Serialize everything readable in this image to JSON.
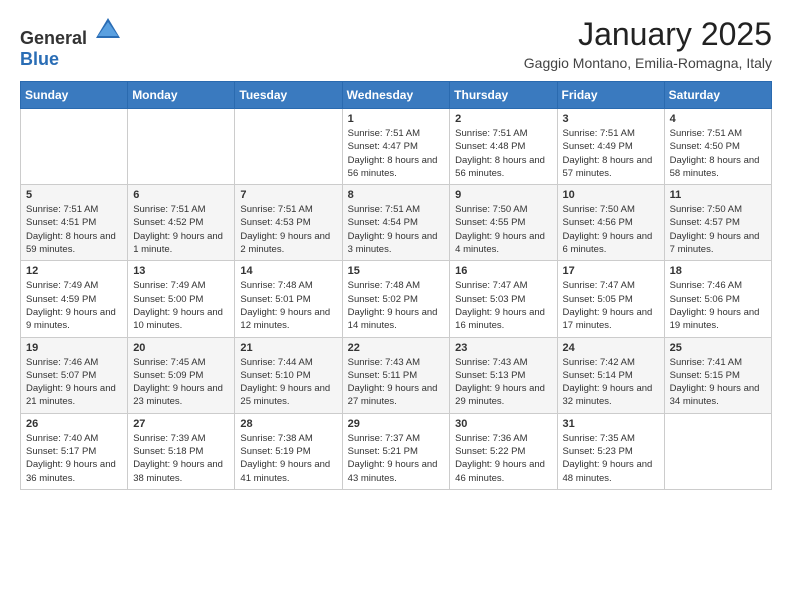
{
  "logo": {
    "general": "General",
    "blue": "Blue"
  },
  "header": {
    "month": "January 2025",
    "location": "Gaggio Montano, Emilia-Romagna, Italy"
  },
  "weekdays": [
    "Sunday",
    "Monday",
    "Tuesday",
    "Wednesday",
    "Thursday",
    "Friday",
    "Saturday"
  ],
  "weeks": [
    [
      {
        "day": "",
        "sunrise": "",
        "sunset": "",
        "daylight": ""
      },
      {
        "day": "",
        "sunrise": "",
        "sunset": "",
        "daylight": ""
      },
      {
        "day": "",
        "sunrise": "",
        "sunset": "",
        "daylight": ""
      },
      {
        "day": "1",
        "sunrise": "Sunrise: 7:51 AM",
        "sunset": "Sunset: 4:47 PM",
        "daylight": "Daylight: 8 hours and 56 minutes."
      },
      {
        "day": "2",
        "sunrise": "Sunrise: 7:51 AM",
        "sunset": "Sunset: 4:48 PM",
        "daylight": "Daylight: 8 hours and 56 minutes."
      },
      {
        "day": "3",
        "sunrise": "Sunrise: 7:51 AM",
        "sunset": "Sunset: 4:49 PM",
        "daylight": "Daylight: 8 hours and 57 minutes."
      },
      {
        "day": "4",
        "sunrise": "Sunrise: 7:51 AM",
        "sunset": "Sunset: 4:50 PM",
        "daylight": "Daylight: 8 hours and 58 minutes."
      }
    ],
    [
      {
        "day": "5",
        "sunrise": "Sunrise: 7:51 AM",
        "sunset": "Sunset: 4:51 PM",
        "daylight": "Daylight: 8 hours and 59 minutes."
      },
      {
        "day": "6",
        "sunrise": "Sunrise: 7:51 AM",
        "sunset": "Sunset: 4:52 PM",
        "daylight": "Daylight: 9 hours and 1 minute."
      },
      {
        "day": "7",
        "sunrise": "Sunrise: 7:51 AM",
        "sunset": "Sunset: 4:53 PM",
        "daylight": "Daylight: 9 hours and 2 minutes."
      },
      {
        "day": "8",
        "sunrise": "Sunrise: 7:51 AM",
        "sunset": "Sunset: 4:54 PM",
        "daylight": "Daylight: 9 hours and 3 minutes."
      },
      {
        "day": "9",
        "sunrise": "Sunrise: 7:50 AM",
        "sunset": "Sunset: 4:55 PM",
        "daylight": "Daylight: 9 hours and 4 minutes."
      },
      {
        "day": "10",
        "sunrise": "Sunrise: 7:50 AM",
        "sunset": "Sunset: 4:56 PM",
        "daylight": "Daylight: 9 hours and 6 minutes."
      },
      {
        "day": "11",
        "sunrise": "Sunrise: 7:50 AM",
        "sunset": "Sunset: 4:57 PM",
        "daylight": "Daylight: 9 hours and 7 minutes."
      }
    ],
    [
      {
        "day": "12",
        "sunrise": "Sunrise: 7:49 AM",
        "sunset": "Sunset: 4:59 PM",
        "daylight": "Daylight: 9 hours and 9 minutes."
      },
      {
        "day": "13",
        "sunrise": "Sunrise: 7:49 AM",
        "sunset": "Sunset: 5:00 PM",
        "daylight": "Daylight: 9 hours and 10 minutes."
      },
      {
        "day": "14",
        "sunrise": "Sunrise: 7:48 AM",
        "sunset": "Sunset: 5:01 PM",
        "daylight": "Daylight: 9 hours and 12 minutes."
      },
      {
        "day": "15",
        "sunrise": "Sunrise: 7:48 AM",
        "sunset": "Sunset: 5:02 PM",
        "daylight": "Daylight: 9 hours and 14 minutes."
      },
      {
        "day": "16",
        "sunrise": "Sunrise: 7:47 AM",
        "sunset": "Sunset: 5:03 PM",
        "daylight": "Daylight: 9 hours and 16 minutes."
      },
      {
        "day": "17",
        "sunrise": "Sunrise: 7:47 AM",
        "sunset": "Sunset: 5:05 PM",
        "daylight": "Daylight: 9 hours and 17 minutes."
      },
      {
        "day": "18",
        "sunrise": "Sunrise: 7:46 AM",
        "sunset": "Sunset: 5:06 PM",
        "daylight": "Daylight: 9 hours and 19 minutes."
      }
    ],
    [
      {
        "day": "19",
        "sunrise": "Sunrise: 7:46 AM",
        "sunset": "Sunset: 5:07 PM",
        "daylight": "Daylight: 9 hours and 21 minutes."
      },
      {
        "day": "20",
        "sunrise": "Sunrise: 7:45 AM",
        "sunset": "Sunset: 5:09 PM",
        "daylight": "Daylight: 9 hours and 23 minutes."
      },
      {
        "day": "21",
        "sunrise": "Sunrise: 7:44 AM",
        "sunset": "Sunset: 5:10 PM",
        "daylight": "Daylight: 9 hours and 25 minutes."
      },
      {
        "day": "22",
        "sunrise": "Sunrise: 7:43 AM",
        "sunset": "Sunset: 5:11 PM",
        "daylight": "Daylight: 9 hours and 27 minutes."
      },
      {
        "day": "23",
        "sunrise": "Sunrise: 7:43 AM",
        "sunset": "Sunset: 5:13 PM",
        "daylight": "Daylight: 9 hours and 29 minutes."
      },
      {
        "day": "24",
        "sunrise": "Sunrise: 7:42 AM",
        "sunset": "Sunset: 5:14 PM",
        "daylight": "Daylight: 9 hours and 32 minutes."
      },
      {
        "day": "25",
        "sunrise": "Sunrise: 7:41 AM",
        "sunset": "Sunset: 5:15 PM",
        "daylight": "Daylight: 9 hours and 34 minutes."
      }
    ],
    [
      {
        "day": "26",
        "sunrise": "Sunrise: 7:40 AM",
        "sunset": "Sunset: 5:17 PM",
        "daylight": "Daylight: 9 hours and 36 minutes."
      },
      {
        "day": "27",
        "sunrise": "Sunrise: 7:39 AM",
        "sunset": "Sunset: 5:18 PM",
        "daylight": "Daylight: 9 hours and 38 minutes."
      },
      {
        "day": "28",
        "sunrise": "Sunrise: 7:38 AM",
        "sunset": "Sunset: 5:19 PM",
        "daylight": "Daylight: 9 hours and 41 minutes."
      },
      {
        "day": "29",
        "sunrise": "Sunrise: 7:37 AM",
        "sunset": "Sunset: 5:21 PM",
        "daylight": "Daylight: 9 hours and 43 minutes."
      },
      {
        "day": "30",
        "sunrise": "Sunrise: 7:36 AM",
        "sunset": "Sunset: 5:22 PM",
        "daylight": "Daylight: 9 hours and 46 minutes."
      },
      {
        "day": "31",
        "sunrise": "Sunrise: 7:35 AM",
        "sunset": "Sunset: 5:23 PM",
        "daylight": "Daylight: 9 hours and 48 minutes."
      },
      {
        "day": "",
        "sunrise": "",
        "sunset": "",
        "daylight": ""
      }
    ]
  ]
}
